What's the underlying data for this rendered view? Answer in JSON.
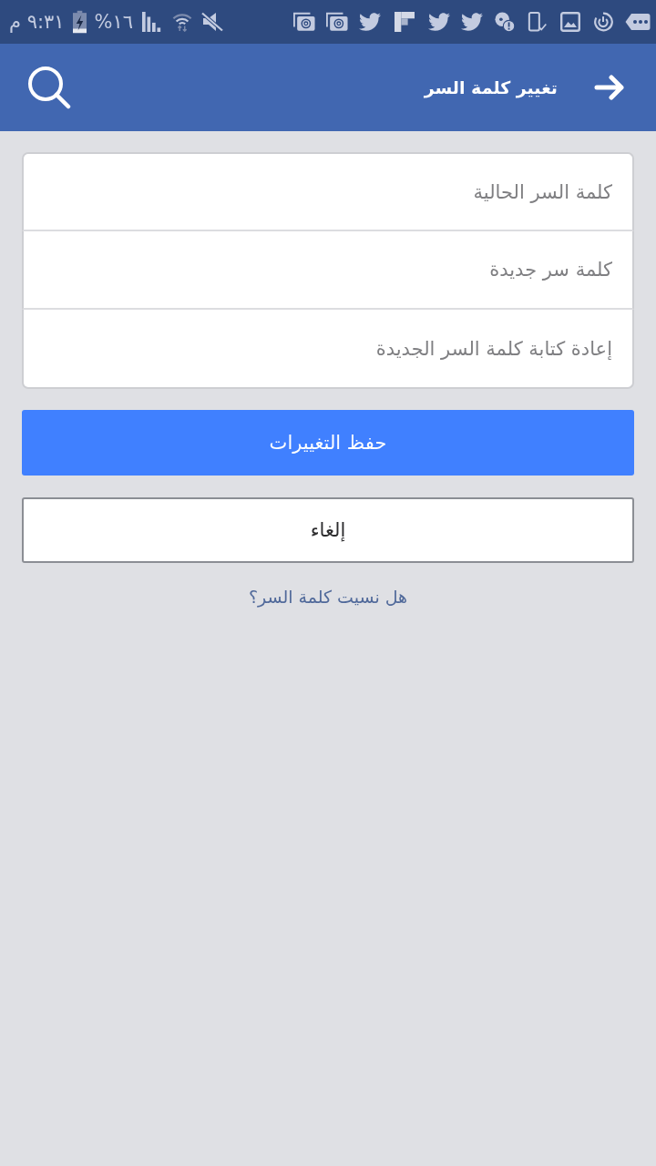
{
  "status_bar": {
    "time": "٩:٣١ م",
    "battery": "١٦%"
  },
  "header": {
    "title": "تغيير كلمة السر"
  },
  "fields": [
    {
      "placeholder": "كلمة السر الحالية"
    },
    {
      "placeholder": "كلمة سر جديدة"
    },
    {
      "placeholder": "إعادة كتابة كلمة السر الجديدة"
    }
  ],
  "save_button": {
    "label": "حفظ التغييرات"
  },
  "cancel_button": {
    "label": "إلغاء"
  },
  "forgot_link": {
    "label": "هل نسيت كلمة السر؟"
  }
}
